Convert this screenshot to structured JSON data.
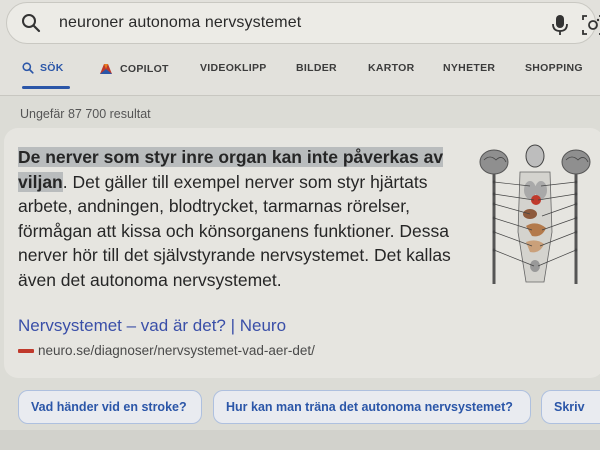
{
  "search": {
    "query": "neuroner autonoma nervsystemet"
  },
  "tabs": [
    {
      "label": "SÖK",
      "icon": "search-icon",
      "active": true
    },
    {
      "label": "COPILOT",
      "icon": "copilot-icon",
      "active": false
    },
    {
      "label": "VIDEOKLIPP",
      "active": false
    },
    {
      "label": "BILDER",
      "active": false
    },
    {
      "label": "KARTOR",
      "active": false
    },
    {
      "label": "NYHETER",
      "active": false
    },
    {
      "label": "SHOPPING",
      "active": false
    }
  ],
  "results_count": "Ungefär 87 700 resultat",
  "answer": {
    "highlight": "De nerver som styr inre organ kan inte påverkas av viljan",
    "text": ". Det gäller till exempel nerver som styr hjärtats arbete, andningen, blodtrycket, tarmarnas rörelser, förmågan att kissa och könsorganens funktioner. Dessa nerver hör till det självstyrande nervsystemet. Det kallas även det autonoma nervsystemet.",
    "image": "autonomic-nervous-system-diagram"
  },
  "result": {
    "title": "Nervsystemet – vad är det? | Neuro",
    "url": "neuro.se/diagnoser/nervsystemet-vad-aer-det/"
  },
  "suggestions": [
    "Vad händer vid en stroke?",
    "Hur kan man träna det autonoma nervsystemet?",
    "Skriv"
  ],
  "colors": {
    "accent": "#2b56a8",
    "link": "#3a4fa8",
    "highlight": "#b9bcbd"
  }
}
